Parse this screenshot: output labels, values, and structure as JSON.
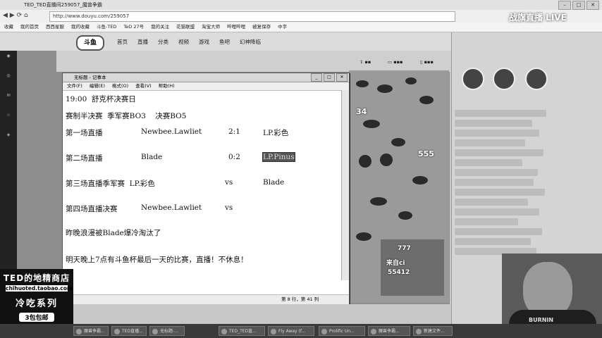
{
  "browser": {
    "tab_title": "TED_TED直播间259057_魔兽争霸",
    "url": "http://www.douyu.com/259057",
    "bookmarks": [
      "收藏",
      "我的首页",
      "西西星服",
      "我的收藏",
      "斗鱼-TED",
      "TeD 27号",
      "我的关注",
      "花猫联盟",
      "淘宝大师",
      "哔哩哔哩",
      "被复保存",
      "中字"
    ],
    "watermark": "战旗直播 LIVE"
  },
  "site": {
    "logo": "斗鱼",
    "nav": [
      "首页",
      "直播",
      "分类",
      "视频",
      "游戏",
      "鱼吧",
      "幻神降临"
    ]
  },
  "notepad": {
    "title": "无标题 - 记事本",
    "menu": [
      "文件(F)",
      "编辑(E)",
      "格式(O)",
      "查看(V)",
      "帮助(H)"
    ],
    "lines": {
      "l1": "19:00  舒克杯决赛日",
      "l2": "赛制半决赛  季军赛BO3    决赛BO5",
      "r1_a": "第一场直播",
      "r1_b": "Newbee.Lawliet",
      "r1_c": "2:1",
      "r1_d": "LP.彩色",
      "r2_a": "第二场直播",
      "r2_b": "Blade",
      "r2_c": "0:2",
      "r2_d": "LP.Pinus",
      "r3_a": "第三场直播季军赛  LP.彩色",
      "r3_c": "vs",
      "r3_d": "Blade",
      "r4_a": "第四场直播决赛",
      "r4_b": "Newbee.Lawliet",
      "r4_c": "vs",
      "l7": "昨晚浪漫被Blade爆冷淘汰了",
      "l8": "明天晚上7点有斗鱼杯最后一天的比赛，直播！不休息！"
    },
    "status": "第 8 行，第 41 列"
  },
  "game": {
    "texts": [
      "34",
      "555",
      "777",
      "55412"
    ],
    "popup": [
      "来自ci",
      "55412"
    ]
  },
  "shop": {
    "name": "TED的地精商店",
    "url": "chihuoted.taobao.com",
    "series": "冷吃系列",
    "badge": "3包包邮"
  },
  "cam": {
    "shirt": "BURNIN"
  },
  "taskbar": {
    "items": [
      "魔兽争霸...",
      "TED直播...",
      "无标题-...",
      "TED_TED直...",
      "Fly Away (f...",
      "Prolific Un...",
      "魔兽争霸...",
      "新建文件..."
    ]
  }
}
